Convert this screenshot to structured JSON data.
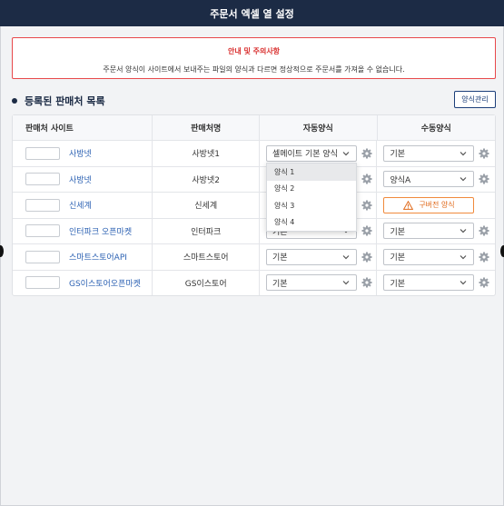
{
  "title": "주문서 엑셀 열 설정",
  "notice": {
    "title": "안내 및 주의사항",
    "text": "주문서 양식이 사이트에서 보내주는 파일의 양식과 다르면 정상적으로 주문서를 가져올 수 없습니다."
  },
  "section": {
    "title": "등록된 판매처 목록",
    "manage_label": "양식관리"
  },
  "table": {
    "headers": [
      "판매처 사이트",
      "판매처명",
      "자동양식",
      "수동양식"
    ],
    "rows": [
      {
        "site": "사방넷",
        "name": "사방넷1",
        "auto": "셀메이트 기본 양식",
        "manual": "기본"
      },
      {
        "site": "사방넷",
        "name": "사방넷2",
        "auto": "",
        "manual": "양식A"
      },
      {
        "site": "신세계",
        "name": "신세계",
        "auto": "",
        "manual": "구버전 양식"
      },
      {
        "site": "인터파크 오픈마켓",
        "name": "인터파크",
        "auto": "기본",
        "manual": "기본"
      },
      {
        "site": "스마트스토어API",
        "name": "스마트스토어",
        "auto": "기본",
        "manual": "기본"
      },
      {
        "site": "GS이스토어오픈마켓",
        "name": "GS이스토어",
        "auto": "기본",
        "manual": "기본"
      }
    ]
  },
  "dropdown": {
    "options": [
      "양식 1",
      "양식 2",
      "양식 3",
      "양식 4"
    ],
    "highlighted": "양식 1"
  },
  "colors": {
    "header_bg": "#1c2b45",
    "accent_red": "#e8484b",
    "link_blue": "#2d62b3",
    "warning_orange": "#e0691a"
  }
}
